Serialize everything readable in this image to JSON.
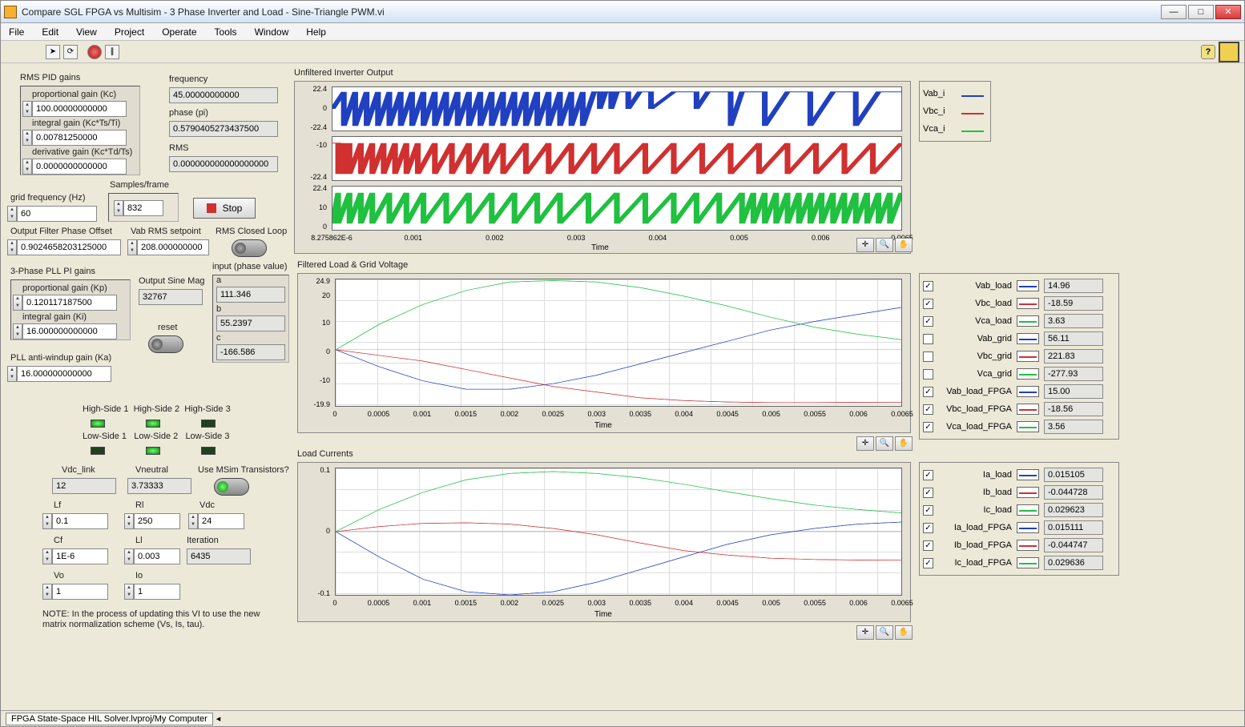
{
  "window": {
    "title": "Compare SGL FPGA vs Multisim - 3 Phase Inverter and Load - Sine-Triangle PWM.vi"
  },
  "menu": [
    "File",
    "Edit",
    "View",
    "Project",
    "Operate",
    "Tools",
    "Window",
    "Help"
  ],
  "toolbar": {
    "help": "?"
  },
  "rms_pid": {
    "heading": "RMS PID gains",
    "kc_label": "proportional gain (Kc)",
    "kc": "100.00000000000",
    "ti_label": "integral gain (Kc*Ts/Ti)",
    "ti": "0.00781250000",
    "td_label": "derivative gain (Kc*Td/Ts)",
    "td": "0.0000000000000"
  },
  "freq": {
    "label": "frequency",
    "value": "45.00000000000"
  },
  "phase": {
    "label": "phase (pi)",
    "value": "0.5790405273437500"
  },
  "rms": {
    "label": "RMS",
    "value": "0.000000000000000000"
  },
  "grid_freq": {
    "label": "grid frequency (Hz)",
    "value": "60"
  },
  "samples": {
    "label": "Samples/frame",
    "value": "832"
  },
  "stop_label": "Stop",
  "ofpo": {
    "label": "Output Filter Phase Offset",
    "value": "0.9024658203125000"
  },
  "vab_set": {
    "label": "Vab RMS setpoint",
    "value": "208.000000000"
  },
  "rms_closed": "RMS Closed Loop",
  "pll": {
    "heading": "3-Phase PLL PI gains",
    "kp_label": "proportional gain (Kp)",
    "kp": "0.120117187500",
    "ki_label": "integral gain (Ki)",
    "ki": "16.000000000000"
  },
  "pll_aw": {
    "label": "PLL anti-windup gain (Ka)",
    "value": "16.000000000000"
  },
  "sine_mag": {
    "label": "Output Sine Mag",
    "value": "32767"
  },
  "reset": "reset",
  "input_pv": {
    "label": "input (phase value)",
    "a_lbl": "a",
    "a": "111.346",
    "b_lbl": "b",
    "b": "55.2397",
    "c_lbl": "c",
    "c": "-166.586"
  },
  "sides": {
    "h1": "High-Side 1",
    "h2": "High-Side 2",
    "h3": "High-Side 3",
    "l1": "Low-Side 1",
    "l2": "Low-Side 2",
    "l3": "Low-Side 3"
  },
  "dc": {
    "vdc_link_lbl": "Vdc_link",
    "vdc_link": "12",
    "vneutral_lbl": "Vneutral",
    "vneutral": "3.73333",
    "msim": "Use MSim Transistors?",
    "lf_lbl": "Lf",
    "lf": "0.1",
    "rl_lbl": "Rl",
    "rl": "250",
    "vdc_lbl": "Vdc",
    "vdc": "24",
    "cf_lbl": "Cf",
    "cf": "1E-6",
    "ll_lbl": "Ll",
    "ll": "0.003",
    "iter_lbl": "Iteration",
    "iter": "6435",
    "vo_lbl": "Vo",
    "vo": "1",
    "io_lbl": "Io",
    "io": "1"
  },
  "note": "NOTE: In the process of updating this VI to use the new matrix normalization scheme (Vs, Is, tau).",
  "chart1": {
    "title": "Unfiltered Inverter Output",
    "y": [
      "22.4",
      "0",
      "-22.4",
      "-10",
      "-22.4",
      "22.4",
      "10",
      "0"
    ],
    "x": [
      "8.275862E-6",
      "0.001",
      "0.002",
      "0.003",
      "0.004",
      "0.005",
      "0.006",
      "0.0065"
    ],
    "xlabel": "Time",
    "legend": [
      [
        "Vab_i",
        "#2040c0"
      ],
      [
        "Vbc_i",
        "#d03030"
      ],
      [
        "Vca_i",
        "#20c040"
      ]
    ]
  },
  "chart2": {
    "title": "Filtered Load &  Grid Voltage",
    "y": [
      "24.9",
      "20",
      "10",
      "0",
      "-10",
      "-19.9"
    ],
    "x": [
      "0",
      "0.0005",
      "0.001",
      "0.0015",
      "0.002",
      "0.0025",
      "0.003",
      "0.0035",
      "0.004",
      "0.0045",
      "0.005",
      "0.0055",
      "0.006",
      "0.0065"
    ],
    "xlabel": "Time",
    "legend": [
      {
        "cb": true,
        "name": "Vab_load",
        "color": "#2040c0",
        "val": "14.96"
      },
      {
        "cb": true,
        "name": "Vbc_load",
        "color": "#d03030",
        "val": "-18.59"
      },
      {
        "cb": true,
        "name": "Vca_load",
        "color": "#20c040",
        "val": "3.63"
      },
      {
        "cb": false,
        "name": "Vab_grid",
        "color": "#2040c0",
        "val": "56.11"
      },
      {
        "cb": false,
        "name": "Vbc_grid",
        "color": "#d03030",
        "val": "221.83"
      },
      {
        "cb": false,
        "name": "Vca_grid",
        "color": "#20c040",
        "val": "-277.93"
      },
      {
        "cb": true,
        "name": "Vab_load_FPGA",
        "color": "#2040c0",
        "val": "15.00"
      },
      {
        "cb": true,
        "name": "Vbc_load_FPGA",
        "color": "#d03030",
        "val": "-18.56"
      },
      {
        "cb": true,
        "name": "Vca_load_FPGA",
        "color": "#20c040",
        "val": "3.56"
      }
    ]
  },
  "chart3": {
    "title": "Load Currents",
    "y": [
      "0.1",
      "0",
      "-0.1"
    ],
    "x": [
      "0",
      "0.0005",
      "0.001",
      "0.0015",
      "0.002",
      "0.0025",
      "0.003",
      "0.0035",
      "0.004",
      "0.0045",
      "0.005",
      "0.0055",
      "0.006",
      "0.0065"
    ],
    "xlabel": "Time",
    "legend": [
      {
        "cb": true,
        "name": "Ia_load",
        "color": "#2040c0",
        "val": "0.015105"
      },
      {
        "cb": true,
        "name": "Ib_load",
        "color": "#d03030",
        "val": "-0.044728"
      },
      {
        "cb": true,
        "name": "Ic_load",
        "color": "#20c040",
        "val": "0.029623"
      },
      {
        "cb": true,
        "name": "Ia_load_FPGA",
        "color": "#2040c0",
        "val": "0.015111"
      },
      {
        "cb": true,
        "name": "Ib_load_FPGA",
        "color": "#d03030",
        "val": "-0.044747"
      },
      {
        "cb": true,
        "name": "Ic_load_FPGA",
        "color": "#20c040",
        "val": "0.029636"
      }
    ]
  },
  "status": {
    "path": "FPGA State-Space HIL Solver.lvproj/My Computer"
  },
  "chart_data": [
    {
      "type": "line",
      "title": "Unfiltered Inverter Output",
      "xlabel": "Time",
      "ylabel": "",
      "xlim": [
        8.275862e-06,
        0.0065
      ],
      "panels": [
        {
          "series": "Vab_i",
          "color": "#2040c0",
          "ylim": [
            -22.4,
            22.4
          ],
          "note": "PWM square wave ±22.4, duty transition near t≈0.003"
        },
        {
          "series": "Vbc_i",
          "color": "#d03030",
          "ylim": [
            -22.4,
            -10
          ],
          "note": "PWM square wave"
        },
        {
          "series": "Vca_i",
          "color": "#20c040",
          "ylim": [
            0,
            22.4
          ],
          "note": "PWM square wave"
        }
      ]
    },
    {
      "type": "line",
      "title": "Filtered Load & Grid Voltage",
      "xlabel": "Time",
      "ylabel": "",
      "xlim": [
        0,
        0.0065
      ],
      "ylim": [
        -19.9,
        24.9
      ],
      "x": [
        0,
        0.0005,
        0.001,
        0.0015,
        0.002,
        0.0025,
        0.003,
        0.0035,
        0.004,
        0.0045,
        0.005,
        0.0055,
        0.006,
        0.0065
      ],
      "series": [
        {
          "name": "Vab_load",
          "color": "#2040c0",
          "values": [
            0,
            -6,
            -11,
            -14,
            -14,
            -12,
            -9,
            -5,
            -1,
            3,
            7,
            10,
            12.5,
            14.96
          ]
        },
        {
          "name": "Vbc_load",
          "color": "#d03030",
          "values": [
            0,
            -2,
            -4,
            -7,
            -10,
            -13,
            -15,
            -17,
            -18,
            -18.5,
            -18.7,
            -18.7,
            -18.6,
            -18.59
          ]
        },
        {
          "name": "Vca_load",
          "color": "#20c040",
          "values": [
            0,
            9,
            16,
            21,
            24,
            24.5,
            24,
            22,
            19,
            15.5,
            11.5,
            8,
            5.5,
            3.63
          ]
        },
        {
          "name": "Vab_load_FPGA",
          "color": "#2040c0",
          "values": [
            0,
            -6,
            -11,
            -14,
            -14,
            -12,
            -9,
            -5,
            -1,
            3,
            7,
            10,
            12.5,
            15.0
          ]
        },
        {
          "name": "Vbc_load_FPGA",
          "color": "#d03030",
          "values": [
            0,
            -2,
            -4,
            -7,
            -10,
            -13,
            -15,
            -17,
            -18,
            -18.5,
            -18.7,
            -18.7,
            -18.6,
            -18.56
          ]
        },
        {
          "name": "Vca_load_FPGA",
          "color": "#20c040",
          "values": [
            0,
            9,
            16,
            21,
            24,
            24.5,
            24,
            22,
            19,
            15.5,
            11.5,
            8,
            5.5,
            3.56
          ]
        }
      ]
    },
    {
      "type": "line",
      "title": "Load Currents",
      "xlabel": "Time",
      "ylabel": "",
      "xlim": [
        0,
        0.0065
      ],
      "ylim": [
        -0.1,
        0.1
      ],
      "x": [
        0,
        0.0005,
        0.001,
        0.0015,
        0.002,
        0.0025,
        0.003,
        0.0035,
        0.004,
        0.0045,
        0.005,
        0.0055,
        0.006,
        0.0065
      ],
      "series": [
        {
          "name": "Ia_load",
          "color": "#2040c0",
          "values": [
            0,
            -0.04,
            -0.075,
            -0.095,
            -0.1,
            -0.095,
            -0.08,
            -0.06,
            -0.04,
            -0.02,
            -0.005,
            0.005,
            0.012,
            0.015105
          ]
        },
        {
          "name": "Ib_load",
          "color": "#d03030",
          "values": [
            0,
            0.008,
            0.013,
            0.014,
            0.012,
            0.005,
            -0.005,
            -0.018,
            -0.03,
            -0.037,
            -0.042,
            -0.044,
            -0.0448,
            -0.044728
          ]
        },
        {
          "name": "Ic_load",
          "color": "#20c040",
          "values": [
            0,
            0.035,
            0.062,
            0.082,
            0.092,
            0.095,
            0.092,
            0.085,
            0.075,
            0.063,
            0.052,
            0.042,
            0.035,
            0.029623
          ]
        },
        {
          "name": "Ia_load_FPGA",
          "color": "#2040c0",
          "values": [
            0,
            -0.04,
            -0.075,
            -0.095,
            -0.1,
            -0.095,
            -0.08,
            -0.06,
            -0.04,
            -0.02,
            -0.005,
            0.005,
            0.012,
            0.015111
          ]
        },
        {
          "name": "Ib_load_FPGA",
          "color": "#d03030",
          "values": [
            0,
            0.008,
            0.013,
            0.014,
            0.012,
            0.005,
            -0.005,
            -0.018,
            -0.03,
            -0.037,
            -0.042,
            -0.044,
            -0.0448,
            -0.044747
          ]
        },
        {
          "name": "Ic_load_FPGA",
          "color": "#20c040",
          "values": [
            0,
            0.035,
            0.062,
            0.082,
            0.092,
            0.095,
            0.092,
            0.085,
            0.075,
            0.063,
            0.052,
            0.042,
            0.035,
            0.029636
          ]
        }
      ]
    }
  ]
}
